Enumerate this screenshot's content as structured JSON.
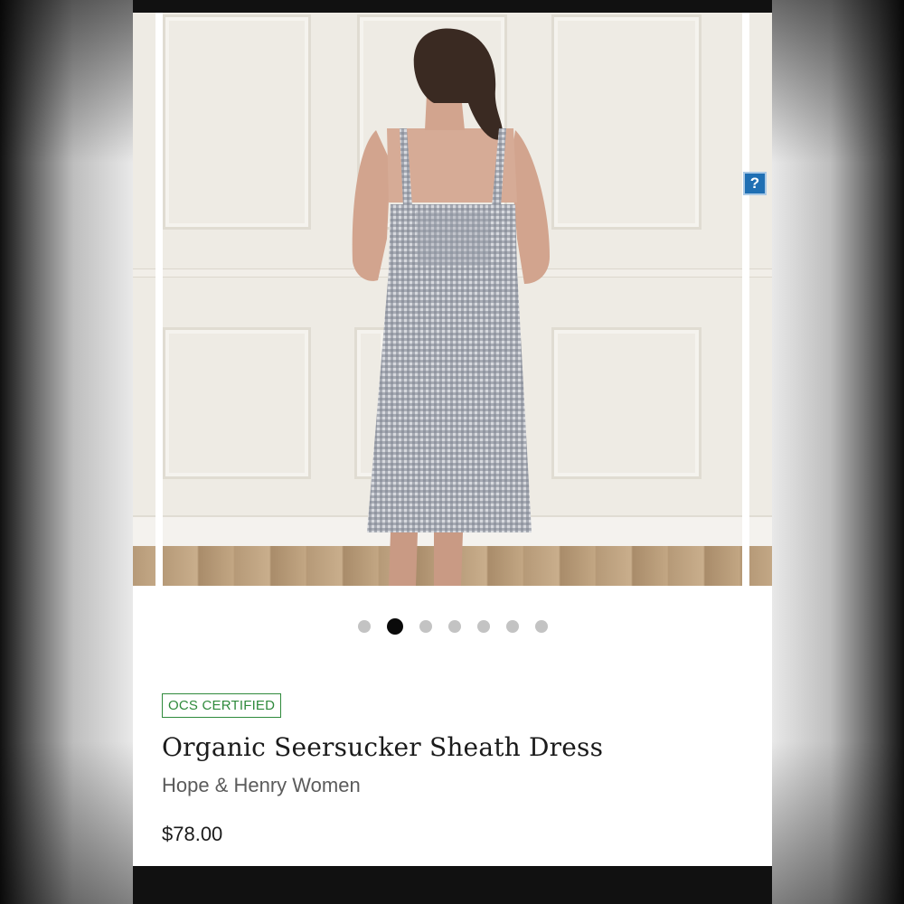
{
  "gallery": {
    "slide_count": 7,
    "active_index": 1,
    "image_description_icon": "person-photo",
    "help_label": "?"
  },
  "product": {
    "badge": "OCS CERTIFIED",
    "title": "Organic Seersucker Sheath Dress",
    "brand": "Hope & Henry Women",
    "price": "$78.00"
  },
  "colors": {
    "badge": "#2f8a3c",
    "active_dot": "#0a0a0a",
    "inactive_dot": "#c3c3c3",
    "help_badge": "#1f6fb3"
  }
}
